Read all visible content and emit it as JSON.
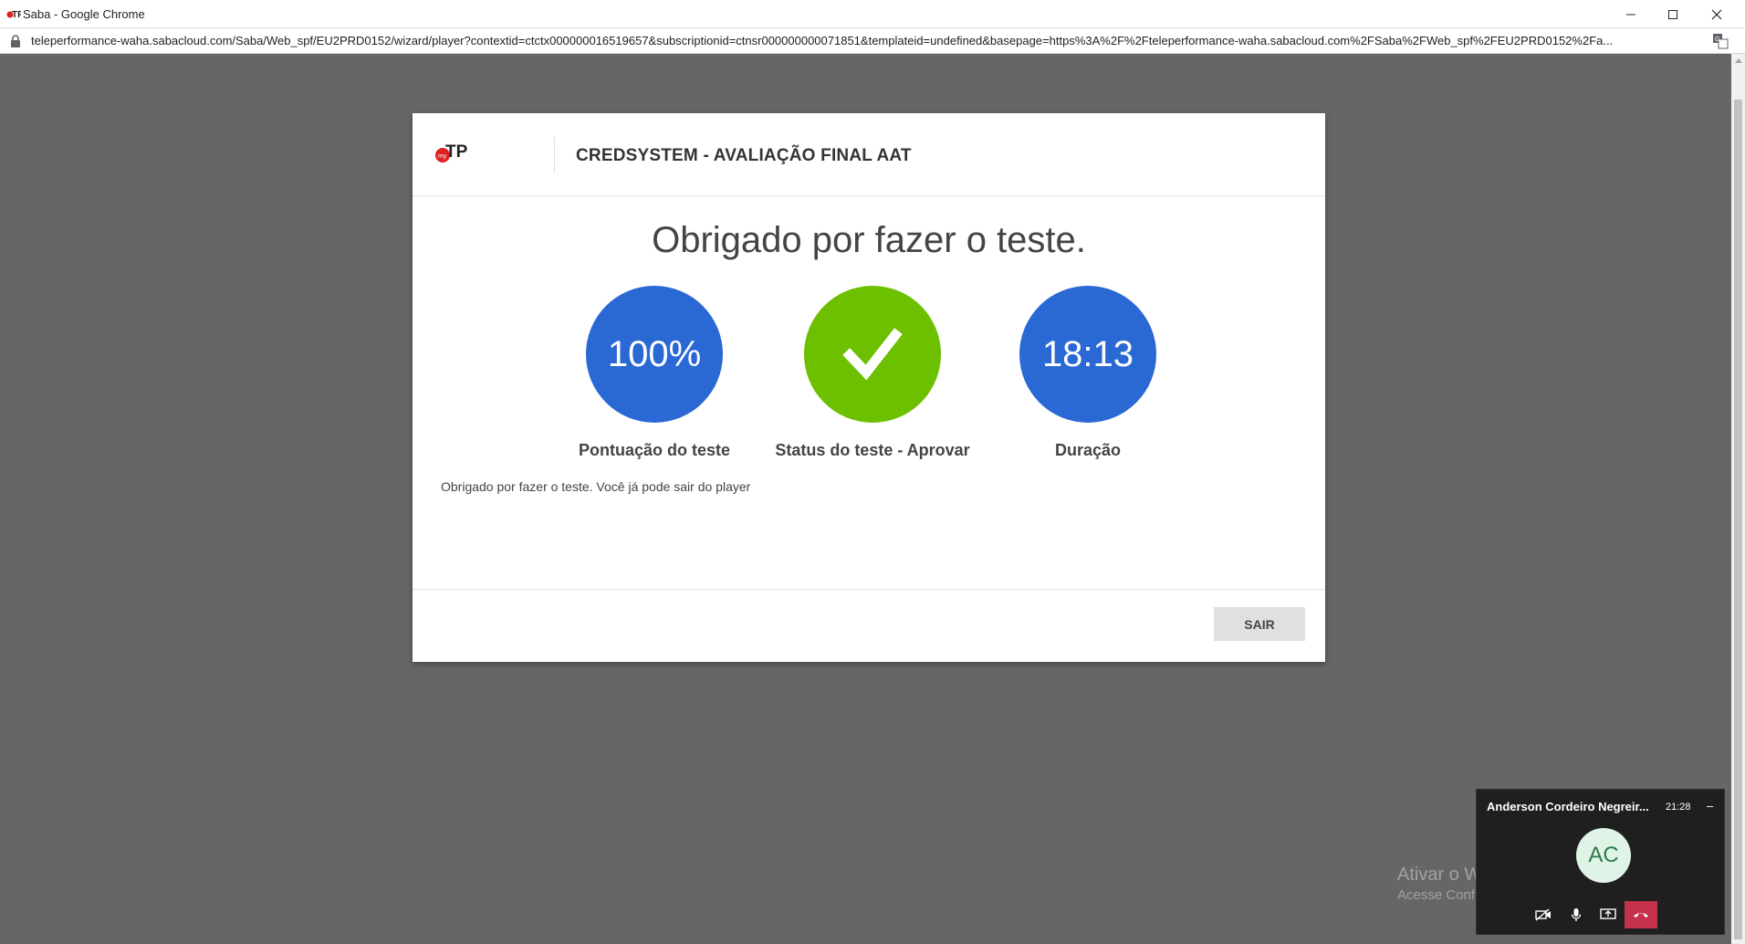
{
  "browser": {
    "window_title": "Saba - Google Chrome",
    "url": "teleperformance-waha.sabacloud.com/Saba/Web_spf/EU2PRD0152/wizard/player?contextid=ctctx000000016519657&subscriptionid=ctnsr000000000071851&templateid=undefined&basepage=https%3A%2F%2Fteleperformance-waha.sabacloud.com%2FSaba%2FWeb_spf%2FEU2PRD0152%2Fa..."
  },
  "modal": {
    "title": "CREDSYSTEM - AVALIAÇÃO FINAL AAT",
    "heading": "Obrigado por fazer o teste.",
    "stats": {
      "score": {
        "value": "100%",
        "label": "Pontuação do teste",
        "color": "#2a68d4"
      },
      "status": {
        "icon": "checkmark-icon",
        "label": "Status do teste - Aprovar",
        "color": "#6cc000"
      },
      "duration": {
        "value": "18:13",
        "label": "Duração",
        "color": "#2a68d4"
      }
    },
    "message": "Obrigado por fazer o teste. Você já pode sair do player",
    "exit_button": "SAIR"
  },
  "watermark": {
    "title": "Ativar o Windows",
    "subtitle": "Acesse Configurações para ativar o Windows."
  },
  "call_widget": {
    "name": "Anderson Cordeiro Negreir...",
    "time": "21:28",
    "minimize": "–",
    "initials": "AC",
    "hangup_color": "#c4314b"
  }
}
